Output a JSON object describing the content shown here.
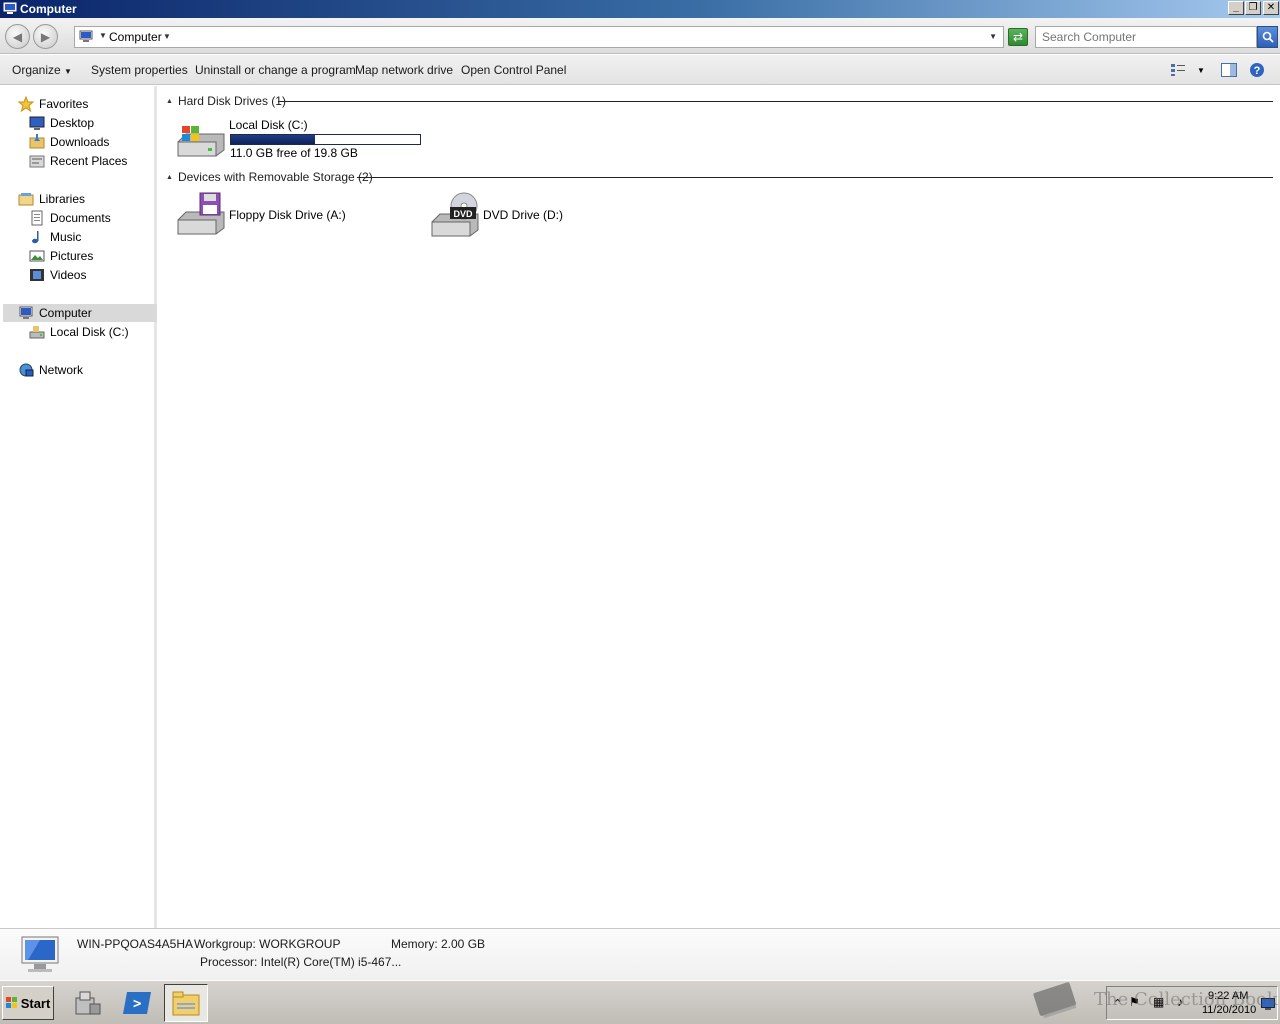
{
  "window": {
    "title": "Computer",
    "minimize": "_",
    "restore": "❐",
    "close": "✕"
  },
  "address": {
    "crumb": "Computer",
    "search_placeholder": "Search Computer"
  },
  "commands": {
    "organize": "Organize",
    "system_properties": "System properties",
    "uninstall": "Uninstall or change a program",
    "map_drive": "Map network drive",
    "control_panel": "Open Control Panel"
  },
  "nav": {
    "favorites": "Favorites",
    "desktop": "Desktop",
    "downloads": "Downloads",
    "recent": "Recent Places",
    "libraries": "Libraries",
    "documents": "Documents",
    "music": "Music",
    "pictures": "Pictures",
    "videos": "Videos",
    "computer": "Computer",
    "local_disk": "Local Disk (C:)",
    "network": "Network"
  },
  "groups": {
    "hdd": "Hard Disk Drives (1)",
    "removable": "Devices with Removable Storage (2)"
  },
  "drives": {
    "c_label": "Local Disk (C:)",
    "c_free": "11.0 GB free of 19.8 GB",
    "c_used_fraction": 0.444,
    "a_label": "Floppy Disk Drive (A:)",
    "d_label": "DVD Drive (D:)",
    "dvd_badge": "DVD"
  },
  "details": {
    "name": "WIN-PPQOAS4A5HA",
    "workgroup": "Workgroup: WORKGROUP",
    "memory": "Memory: 2.00 GB",
    "processor": "Processor: Intel(R) Core(TM) i5-467..."
  },
  "taskbar": {
    "start": "Start",
    "time": "9:22 AM",
    "date": "11/20/2010",
    "watermark": "The Collection Book"
  },
  "colors": {
    "title_start": "#0a246a",
    "title_end": "#a6caf0",
    "capacity_bar": "#0d2358"
  }
}
